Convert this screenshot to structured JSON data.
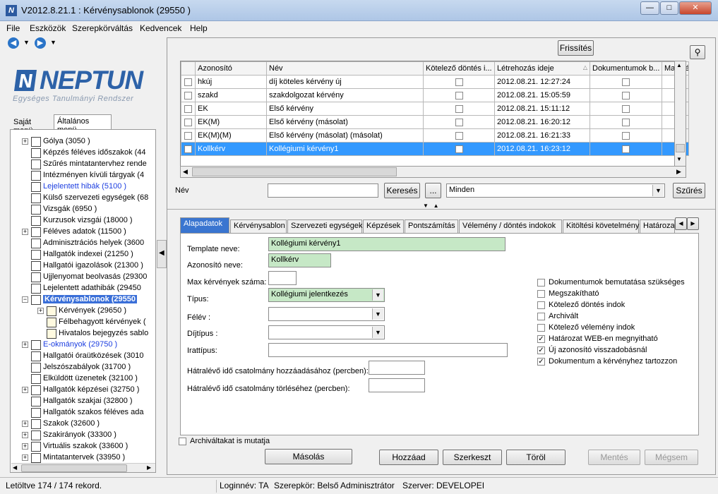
{
  "window": {
    "title": "V2012.8.21.1 : Kérvénysablonok (29550 )",
    "app_icon": "N"
  },
  "menu": [
    "File",
    "Eszközök",
    "Szerepkörváltás",
    "Kedvencek",
    "Help"
  ],
  "logo": {
    "name": "NEPTUN",
    "subtitle": "Egységes Tanulmányi Rendszer"
  },
  "left_tabs": {
    "own": "Saját menü",
    "general": "Általános menü"
  },
  "tree": [
    {
      "label": "Gólya (3050 )",
      "plus": true,
      "blue": false
    },
    {
      "label": "Képzés féléves időszakok (44",
      "plus": false,
      "blue": false
    },
    {
      "label": "Szűrés mintatantervhez rende",
      "plus": false,
      "blue": false
    },
    {
      "label": "Intézményen kívüli tárgyak (4",
      "plus": false,
      "blue": false
    },
    {
      "label": "Lejelentett hibák (5100 )",
      "plus": false,
      "blue": true
    },
    {
      "label": "Külső szervezeti egységek (68",
      "plus": false,
      "blue": false
    },
    {
      "label": "Vizsgák (6950 )",
      "plus": false,
      "blue": false
    },
    {
      "label": "Kurzusok vizsgái (18000 )",
      "plus": false,
      "blue": false
    },
    {
      "label": "Féléves adatok (11500 )",
      "plus": true,
      "blue": false
    },
    {
      "label": "Adminisztrációs helyek (3600",
      "plus": false,
      "blue": false
    },
    {
      "label": "Hallgatók indexei (21250 )",
      "plus": false,
      "blue": false
    },
    {
      "label": "Hallgatói igazolások (21300 )",
      "plus": false,
      "blue": false
    },
    {
      "label": "Ujjlenyomat beolvasás (29300",
      "plus": false,
      "blue": false
    },
    {
      "label": "Lejelentett adathibák (29450",
      "plus": false,
      "blue": false
    },
    {
      "label": "Kérvénysablonok (29550",
      "plus": true,
      "blue": false,
      "selected": true
    },
    {
      "label": "Kérvények (29650 )",
      "plus": true,
      "blue": false,
      "child": true
    },
    {
      "label": "Félbehagyott kérvények (",
      "plus": false,
      "blue": false,
      "child": true
    },
    {
      "label": "Hivatalos bejegyzés sablo",
      "plus": false,
      "blue": false,
      "child": true
    },
    {
      "label": "E-okmányok (29750 )",
      "plus": true,
      "blue": true
    },
    {
      "label": "Hallgatói óraütközések (3010",
      "plus": false,
      "blue": false
    },
    {
      "label": "Jelszószabályok (31700 )",
      "plus": false,
      "blue": false
    },
    {
      "label": "Elküldött üzenetek (32100 )",
      "plus": false,
      "blue": false
    },
    {
      "label": "Hallgatók képzései (32750 )",
      "plus": true,
      "blue": false
    },
    {
      "label": "Hallgatók szakjai (32800 )",
      "plus": false,
      "blue": false
    },
    {
      "label": "Hallgatók szakos féléves ada",
      "plus": false,
      "blue": false
    },
    {
      "label": "Szakok (32600 )",
      "plus": true,
      "blue": false
    },
    {
      "label": "Szakirányok (33300 )",
      "plus": true,
      "blue": false
    },
    {
      "label": "Virtuális szakok (33600 )",
      "plus": true,
      "blue": false
    },
    {
      "label": "Mintatantervek (33950 )",
      "plus": true,
      "blue": false
    }
  ],
  "toolbar": {
    "refresh": "Frissítés"
  },
  "grid": {
    "columns": [
      "Azonosító",
      "Név",
      "Kötelező döntés i...",
      "Létrehozás ideje",
      "Dokumentumok b...",
      "Max kér"
    ],
    "rows": [
      {
        "id": "hkúj",
        "name": "díj köteles kérvény új",
        "date": "2012.08.21. 12:27:24"
      },
      {
        "id": "szakd",
        "name": "szakdolgozat kérvény",
        "date": "2012.08.21. 15:05:59"
      },
      {
        "id": "EK",
        "name": "Első kérvény",
        "date": "2012.08.21. 15:11:12"
      },
      {
        "id": "EK(M)",
        "name": "Első kérvény (másolat)",
        "date": "2012.08.21. 16:20:12"
      },
      {
        "id": "EK(M)(M)",
        "name": "Első kérvény (másolat) (másolat)",
        "date": "2012.08.21. 16:21:33"
      },
      {
        "id": "Kollkérv",
        "name": "Kollégiumi kérvény1",
        "date": "2012.08.21. 16:23:12",
        "selected": true
      }
    ]
  },
  "search": {
    "label": "Név",
    "button": "Keresés",
    "dots": "...",
    "filter": "Minden",
    "filter_button": "Szűrés"
  },
  "tabs": [
    "Alapadatok",
    "Kérvénysablon",
    "Szervezeti egységek",
    "Képzések",
    "Pontszámítás",
    "Vélemény / döntés indokok",
    "Kitöltési követelmény",
    "Határoza"
  ],
  "form": {
    "template_label": "Template neve:",
    "template_value": "Kollégiumi kérvény1",
    "id_label": "Azonosító neve:",
    "id_value": "Kollkérv",
    "max_label": "Max kérvények száma:",
    "max_value": "",
    "type_label": "Típus:",
    "type_value": "Kollégiumi jelentkezés",
    "semester_label": "Félév :",
    "semester_value": "",
    "fee_label": "Díjtípus :",
    "fee_value": "",
    "file_label": "Irattípus:",
    "file_value": "",
    "remain_add_label": "Hátralévő idő csatolmány hozzáadásához (percben):",
    "remain_del_label": "Hátralévő idő csatolmány törléséhez (percben):"
  },
  "checks": [
    {
      "label": "Dokumentumok bemutatása szükséges",
      "checked": false
    },
    {
      "label": "Megszakítható",
      "checked": false
    },
    {
      "label": "Kötelező döntés indok",
      "checked": false
    },
    {
      "label": "Archivált",
      "checked": false
    },
    {
      "label": "Kötelező vélemény indok",
      "checked": false
    },
    {
      "label": "Határozat WEB-en megnyitható",
      "checked": true
    },
    {
      "label": "Új azonosító visszadobásnál",
      "checked": true
    },
    {
      "label": "Dokumentum a kérvényhez tartozzon",
      "checked": true
    }
  ],
  "archive_label": "Archiváltakat is mutatja",
  "buttons": {
    "copy": "Másolás",
    "add": "Hozzáad",
    "edit": "Szerkeszt",
    "delete": "Töröl",
    "save": "Mentés",
    "cancel": "Mégsem"
  },
  "status": {
    "records": "Letöltve 174 / 174 rekord.",
    "login": "Loginnév: TA",
    "role": "Szerepkör: Belső Adminisztrátor",
    "server": "Szerver: DEVELOPEI"
  }
}
